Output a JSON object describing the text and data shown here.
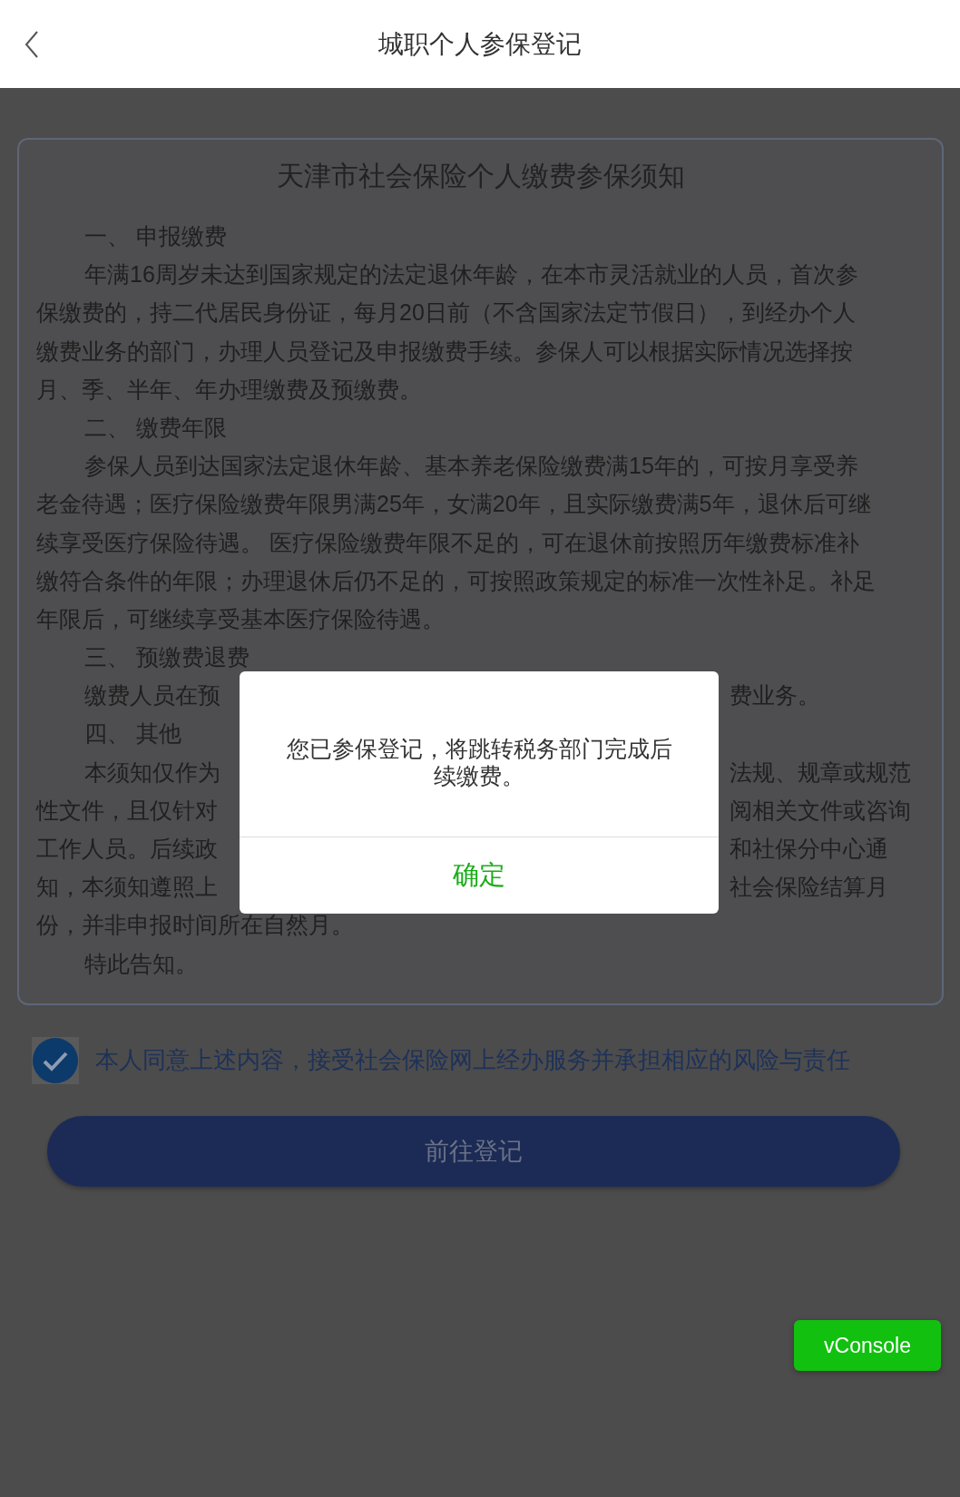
{
  "header": {
    "title": "城职个人参保登记"
  },
  "notice": {
    "title": "天津市社会保险个人缴费参保须知",
    "lines": [
      {
        "kind": "indented",
        "text": "一、 申报缴费"
      },
      {
        "kind": "indented",
        "text": "年满16周岁未达到国家规定的法定退休年龄，在本市灵活就业的人员，首次参"
      },
      {
        "kind": "plain",
        "text": "保缴费的，持二代居民身份证，每月20日前（不含国家法定节假日），到经办个人"
      },
      {
        "kind": "plain",
        "text": "缴费业务的部门，办理人员登记及申报缴费手续。参保人可以根据实际情况选择按"
      },
      {
        "kind": "plain",
        "text": "月、季、半年、年办理缴费及预缴费。"
      },
      {
        "kind": "indented",
        "text": "二、 缴费年限"
      },
      {
        "kind": "indented",
        "text": "参保人员到达国家法定退休年龄、基本养老保险缴费满15年的，可按月享受养"
      },
      {
        "kind": "plain",
        "text": "老金待遇；医疗保险缴费年限男满25年，女满20年，且实际缴费满5年，退休后可继"
      },
      {
        "kind": "plain",
        "text": "续享受医疗保险待遇。 医疗保险缴费年限不足的，可在退休前按照历年缴费标准补"
      },
      {
        "kind": "plain",
        "text": "缴符合条件的年限；办理退休后仍不足的，可按照政策规定的标准一次性补足。补足"
      },
      {
        "kind": "plain",
        "text": "年限后，可继续享受基本医疗保险待遇。"
      },
      {
        "kind": "indented",
        "text": "三、 预缴费退费"
      },
      {
        "kind": "indented",
        "left": "缴费人员在预",
        "right": "费业务。"
      },
      {
        "kind": "indented",
        "text": "四、 其他"
      },
      {
        "kind": "indented",
        "left": "本须知仅作为",
        "right": "法规、规章或规范"
      },
      {
        "kind": "plain",
        "left": "性文件，且仅针对",
        "right": "阅相关文件或咨询"
      },
      {
        "kind": "plain",
        "left": "工作人员。后续政",
        "right": "和社保分中心通"
      },
      {
        "kind": "plain",
        "left": "知，本须知遵照上",
        "right": "社会保险结算月"
      },
      {
        "kind": "plain",
        "text": "份，并非申报时间所在自然月。"
      },
      {
        "kind": "indented",
        "text": "特此告知。"
      }
    ]
  },
  "agreement": {
    "checked": true,
    "text": "本人同意上述内容，接受社会保险网上经办服务并承担相应的风险与责任"
  },
  "submit_button": {
    "label": "前往登记"
  },
  "dialog": {
    "message": "您已参保登记，将跳转税务部门完成后续缴费。",
    "confirm": "确定"
  },
  "vconsole_button": {
    "label": "vConsole"
  }
}
